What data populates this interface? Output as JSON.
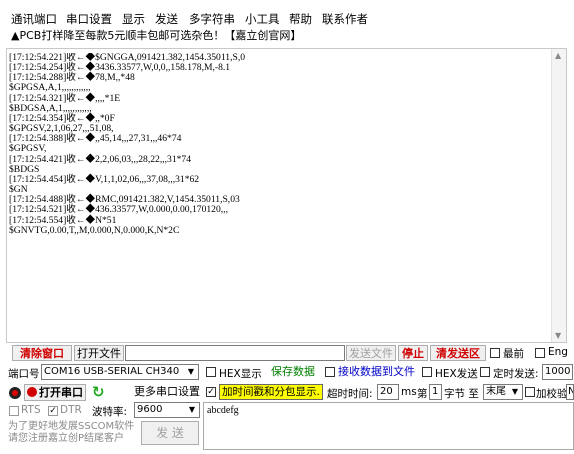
{
  "menu": {
    "items": [
      "通讯端口",
      "串口设置",
      "显示",
      "发送",
      "多字符串",
      "小工具",
      "帮助",
      "联系作者"
    ],
    "promo": "▲PCB打样降至每款5元顺丰包邮可选杂色！【嘉立创官网】"
  },
  "log": {
    "lines": [
      "[17:12:54.221]收←◆$GNGGA,091421.382,1454.35011,S,0",
      "[17:12:54.254]收←◆3436.33577,W,0,0,,158.178,M,-8.1",
      "[17:12:54.288]收←◆78,M,,*48",
      "$GPGSA,A,1,,,,,,,,,,,,",
      "[17:12:54.321]收←◆,,,,*1E",
      "$BDGSA,A,1,,,,,,,,,,,,",
      "[17:12:54.354]收←◆,,*0F",
      "$GPGSV,2,1,06,27,,,51,08,",
      "[17:12:54.388]收←◆,,45,14,,,27,31,,,46*74",
      "$GPGSV,",
      "[17:12:54.421]收←◆2,2,06,03,,,28,22,,,31*74",
      "$BDGS",
      "[17:12:54.454]收←◆V,1,1,02,06,,,37,08,,,31*62",
      "$GN",
      "[17:12:54.488]收←◆RMC,091421.382,V,1454.35011,S,03",
      "[17:12:54.521]收←◆436.33577,W,0.000,0.00,170120,,,",
      "[17:12:54.554]收←◆N*51",
      "$GNVTG,0.00,T,,M,0.000,N,0.000,K,N*2C"
    ]
  },
  "toolbar": {
    "clear_window": "清除窗口",
    "open_file": "打开文件",
    "file_path": "",
    "send_file": "发送文件",
    "stop": "停止",
    "clear_send": "清发送区",
    "topmost": "最前",
    "eng": "Eng"
  },
  "port": {
    "label": "端口号",
    "value": "COM16 USB-SERIAL CH340",
    "open_button": "打开串口",
    "refresh_icon": "refresh-icon",
    "more_settings": "更多串口设置",
    "rts": "RTS",
    "dtr": "DTR",
    "baud_label": "波特率:",
    "baud_value": "9600"
  },
  "options": {
    "hex_display": "HEX显示",
    "save_data": "保存数据",
    "recv_to_file": "接收数据到文件",
    "hex_send": "HEX发送",
    "timed_send": "定时发送:",
    "timed_value": "1000",
    "timestamp_split": "加时间戳和分包显示.",
    "timeout_label": "超时时间:",
    "timeout_value": "20",
    "ms": "ms",
    "frame_label": "第",
    "frame_value": "1",
    "byte_label": "字节 至",
    "end_value": "末尾",
    "checksum": "加校验",
    "checksum_value": "N"
  },
  "send": {
    "text": "abcdefg",
    "button": "发 送"
  },
  "footer": {
    "line1": "为了更好地发展SSCOM软件",
    "line2": "请您注册嘉立创P结尾客户"
  },
  "colors": {
    "accent_red": "#d00000",
    "accent_green": "#008000",
    "accent_blue": "#0000c8",
    "checkbox_highlight": "#ffff00"
  }
}
